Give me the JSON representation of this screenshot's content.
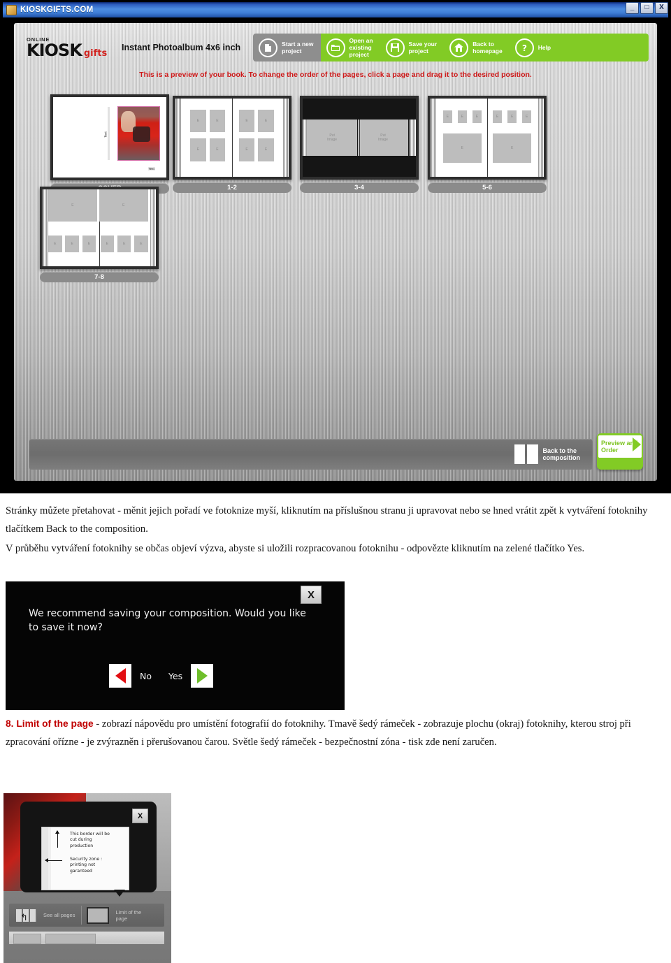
{
  "screenshot_main": {
    "window": {
      "title": "KIOSKGIFTS.COM",
      "minimize": "_",
      "maximize": "□",
      "close": "X"
    },
    "logo": {
      "online": "ONLINE",
      "kiosk": "KIOSK",
      "gifts": "gifts",
      "gifts_color": "#d0231f"
    },
    "product_name": "Instant Photoalbum 4x6 inch",
    "nav": [
      {
        "label": "Start a new\nproject",
        "icon": "new-document-icon",
        "style": "grey",
        "bg": "#8e8e8e"
      },
      {
        "label": "Open an\nexisting\nproject",
        "icon": "open-folder-icon",
        "style": "green",
        "bg": "#82cb25"
      },
      {
        "label": "Save your\nproject",
        "icon": "floppy-disk-icon",
        "style": "green",
        "bg": "#82cb25"
      },
      {
        "label": "Back to\nhomepage",
        "icon": "home-icon",
        "style": "green",
        "bg": "#82cb25"
      },
      {
        "label": "Help",
        "icon": "question-mark-icon",
        "style": "green",
        "bg": "#82cb25"
      }
    ],
    "notice": "This is a preview of your book. To change the order of the pages, click a page and drag it to the desired position.",
    "notice_color": "#cf1a1a",
    "pages": [
      {
        "label": "COVER",
        "type": "cover",
        "cover_text_vertical": "Text",
        "cover_text_corner": "Text"
      },
      {
        "label": "1-2",
        "type": "grid8",
        "slot_label": "E"
      },
      {
        "label": "3-4",
        "type": "band",
        "slot_label": "Put\nImage"
      },
      {
        "label": "5-6",
        "type": "mixed6",
        "slot_label": "E"
      },
      {
        "label": "7-8",
        "type": "split",
        "slot_label": "E"
      }
    ],
    "bottom_bar": {
      "back_label": "Back to the\ncomposition",
      "preview_label": "Preview and\nOrder",
      "preview_color": "#82cb25"
    }
  },
  "paragraph1": "Stránky můžete přetahovat - měnit jejich pořadí ve fotoknize myší, kliknutím na příslušnou stranu ji upravovat nebo se hned vrátit zpět k vytváření fotoknihy tlačítkem Back to the composition.",
  "paragraph2": "V průběhu vytváření fotoknihy se občas objeví výzva, abyste si uložili rozpracovanou fotoknihu - odpovězte kliknutím na zelené tlačítko Yes.",
  "screenshot_dialog": {
    "close_label": "X",
    "message": "We recommend saving your composition. Would you like to save it now?",
    "no_label": "No",
    "yes_label": "Yes",
    "no_color": "#e20e12",
    "yes_color": "#6ebe2a"
  },
  "section8": {
    "heading": "8. Limit of the page",
    "heading_color": "#c00000",
    "body": " - zobrazí nápovědu pro umístění fotografií do fotoknihy. Tmavě šedý rámeček - zobrazuje plochu (okraj) fotoknihy, kterou stroj při zpracování ořízne - je zvýrazněn i přerušovanou čarou. Světle šedý rámeček - bezpečnostní zóna - tisk zde není zaručen."
  },
  "screenshot_limit": {
    "close_label": "X",
    "note_top": "This border will be\ncut during\nproduction",
    "note_bottom": "Security zone :\nprinting not\ngaranteed",
    "toolbar": {
      "see_all_pages": "See all pages",
      "limit_of_the_page": "Limit of the\npage"
    }
  }
}
